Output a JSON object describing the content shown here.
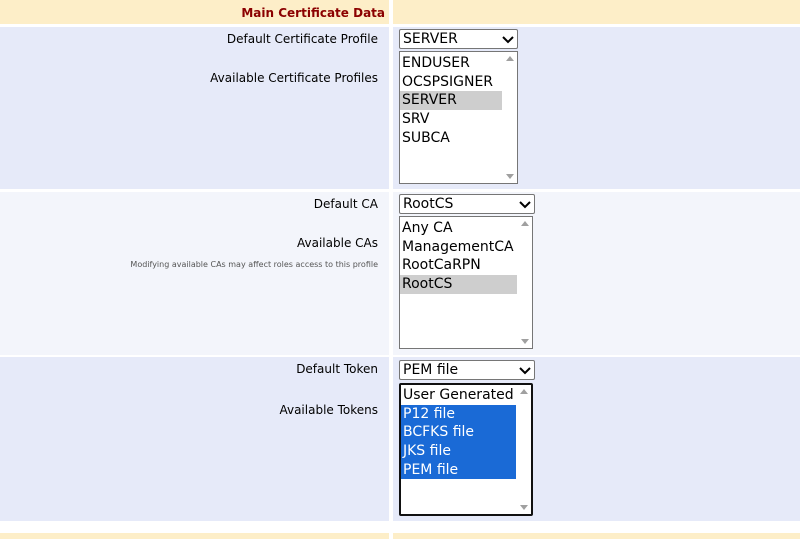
{
  "header": {
    "title": "Main Certificate Data"
  },
  "profiles": {
    "default_label": "Default Certificate Profile",
    "default_value": "SERVER",
    "available_label": "Available Certificate Profiles",
    "options": [
      "ENDUSER",
      "OCSPSIGNER",
      "SERVER",
      "SRV",
      "SUBCA"
    ],
    "selected": [
      "SERVER"
    ]
  },
  "cas": {
    "default_label": "Default CA",
    "default_value": "RootCS",
    "available_label": "Available CAs",
    "note": "Modifying available CAs may affect roles access to this profile",
    "options": [
      "Any CA",
      "ManagementCA",
      "RootCaRPN",
      "RootCS"
    ],
    "selected": [
      "RootCS"
    ]
  },
  "tokens": {
    "default_label": "Default Token",
    "default_value": "PEM file",
    "available_label": "Available Tokens",
    "options": [
      "User Generated",
      "P12 file",
      "BCFKS file",
      "JKS file",
      "PEM file"
    ],
    "selected": [
      "P12 file",
      "BCFKS file",
      "JKS file",
      "PEM file"
    ]
  },
  "icons": {
    "dropdown": "chevron-down-icon",
    "scroll_up": "scroll-up-arrow-icon",
    "scroll_down": "scroll-down-arrow-icon"
  },
  "colors": {
    "header_bg": "#fdeec8",
    "header_text": "#8b0000",
    "band_primary": "#e6eaf9",
    "band_secondary": "#f3f5fb",
    "selected_active": "#1a6ad6",
    "selected_inactive": "#cecece"
  }
}
